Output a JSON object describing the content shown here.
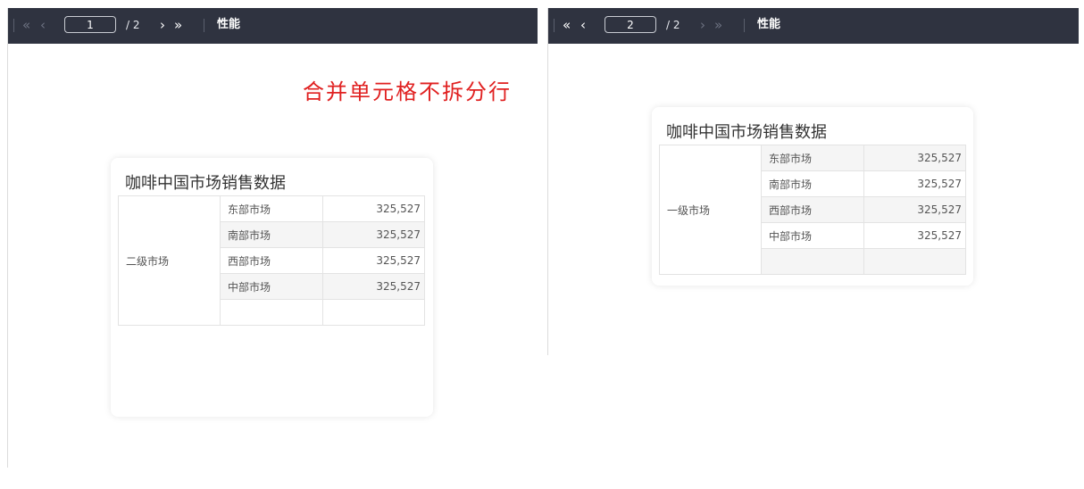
{
  "pages": [
    {
      "toolbar": {
        "first_icon": "«",
        "prev_icon": "‹",
        "current_page": "1",
        "total_pages": "/ 2",
        "next_icon": "›",
        "last_icon": "»",
        "perf_label": "性能"
      },
      "note": "合并单元格不拆分行",
      "card": {
        "title": "咖啡中国市场销售数据",
        "merged_label": "二级市场",
        "rows": [
          {
            "region": "东部市场",
            "value": "325,527"
          },
          {
            "region": "南部市场",
            "value": "325,527"
          },
          {
            "region": "西部市场",
            "value": "325,527"
          },
          {
            "region": "中部市场",
            "value": "325,527"
          },
          {
            "region": "",
            "value": ""
          }
        ]
      }
    },
    {
      "toolbar": {
        "first_icon": "«",
        "prev_icon": "‹",
        "current_page": "2",
        "total_pages": "/ 2",
        "next_icon": "›",
        "last_icon": "»",
        "perf_label": "性能"
      },
      "card": {
        "title": "咖啡中国市场销售数据",
        "merged_label": "一级市场",
        "rows": [
          {
            "region": "东部市场",
            "value": "325,527"
          },
          {
            "region": "南部市场",
            "value": "325,527"
          },
          {
            "region": "西部市场",
            "value": "325,527"
          },
          {
            "region": "中部市场",
            "value": "325,527"
          },
          {
            "region": "",
            "value": ""
          }
        ]
      }
    }
  ],
  "colors": {
    "toolbar_bg": "#2f3340",
    "note_red": "#e02020",
    "stripe": "#f5f5f5"
  }
}
